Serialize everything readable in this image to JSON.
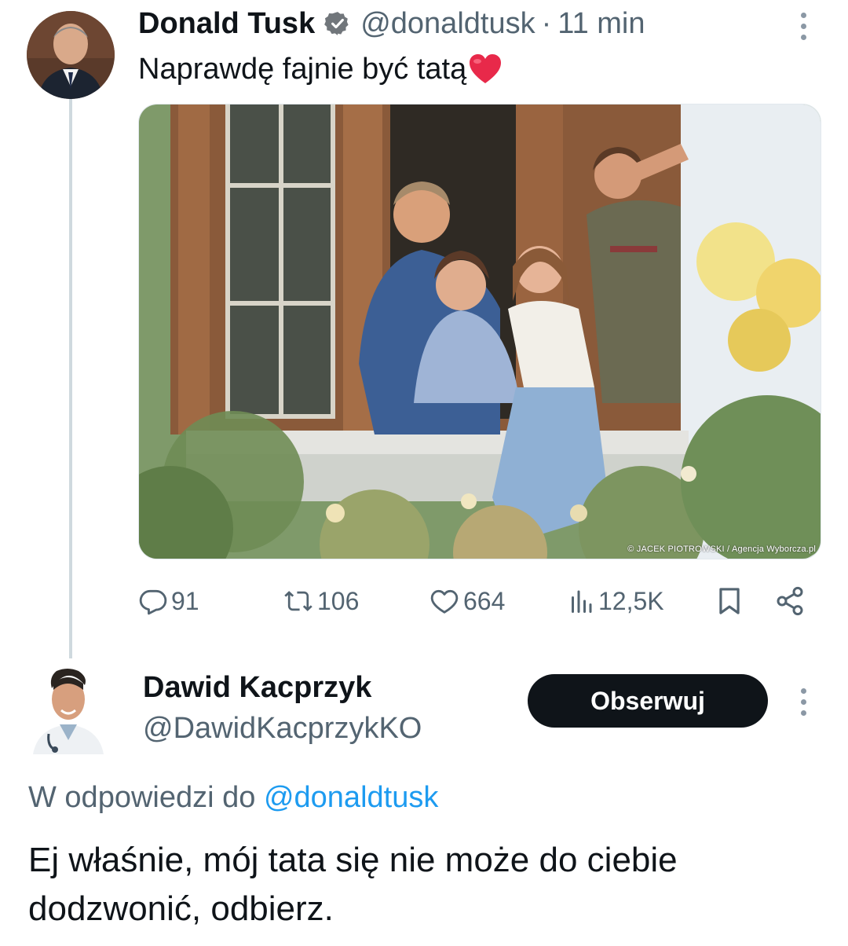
{
  "tweet": {
    "author_name": "Donald Tusk",
    "handle": "@donaldtusk",
    "separator": "·",
    "time": "11 min",
    "text": "Naprawdę fajnie być tatą",
    "text_emoji": "red-heart-emoji",
    "photo_credit": "© JACEK PIOTROWSKI / Agencja Wyborcza.pl",
    "actions": {
      "replies": "91",
      "reposts": "106",
      "likes": "664",
      "views": "12,5K"
    }
  },
  "reply": {
    "author_name": "Dawid Kacprzyk",
    "handle": "@DawidKacprzykKO",
    "follow_label": "Obserwuj",
    "reply_prefix": "W odpowiedzi do",
    "reply_mention": "@donaldtusk",
    "text": "Ej właśnie, mój tata się nie może do ciebie dodzwonić, odbierz."
  },
  "colors": {
    "text_primary": "#0f1419",
    "text_secondary": "#536471",
    "link": "#1d9bf0",
    "thread_line": "#cfd9de",
    "follow_button_bg": "#0f1419",
    "heart": "#f91880"
  }
}
